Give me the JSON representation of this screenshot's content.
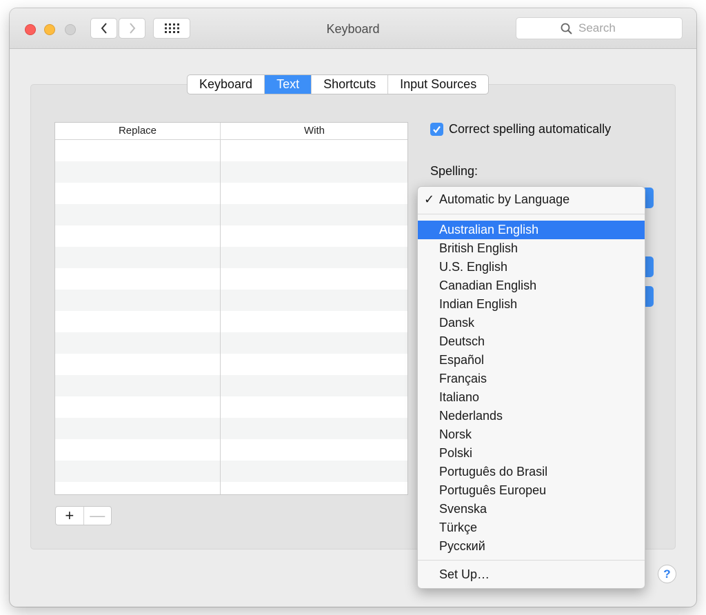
{
  "window": {
    "title": "Keyboard"
  },
  "search": {
    "placeholder": "Search"
  },
  "tabs": [
    {
      "label": "Keyboard",
      "active": false
    },
    {
      "label": "Text",
      "active": true
    },
    {
      "label": "Shortcuts",
      "active": false
    },
    {
      "label": "Input Sources",
      "active": false
    }
  ],
  "table": {
    "columns": [
      "Replace",
      "With"
    ],
    "rows": []
  },
  "controls": {
    "add_label": "+",
    "remove_label": "—"
  },
  "correct_spelling": {
    "label": "Correct spelling automatically",
    "checked": true
  },
  "spelling": {
    "label": "Spelling:"
  },
  "menu": {
    "checked_item": "Automatic by Language",
    "items": [
      "Australian English",
      "British English",
      "U.S. English",
      "Canadian English",
      "Indian English",
      "Dansk",
      "Deutsch",
      "Español",
      "Français",
      "Italiano",
      "Nederlands",
      "Norsk",
      "Polski",
      "Português do Brasil",
      "Português Europeu",
      "Svenska",
      "Türkçe",
      "Русский"
    ],
    "highlighted": "Australian English",
    "footer_item": "Set Up…"
  },
  "help": {
    "label": "?"
  },
  "colors": {
    "accent": "#3d8ff7",
    "menu_highlight": "#2f7bf3"
  }
}
